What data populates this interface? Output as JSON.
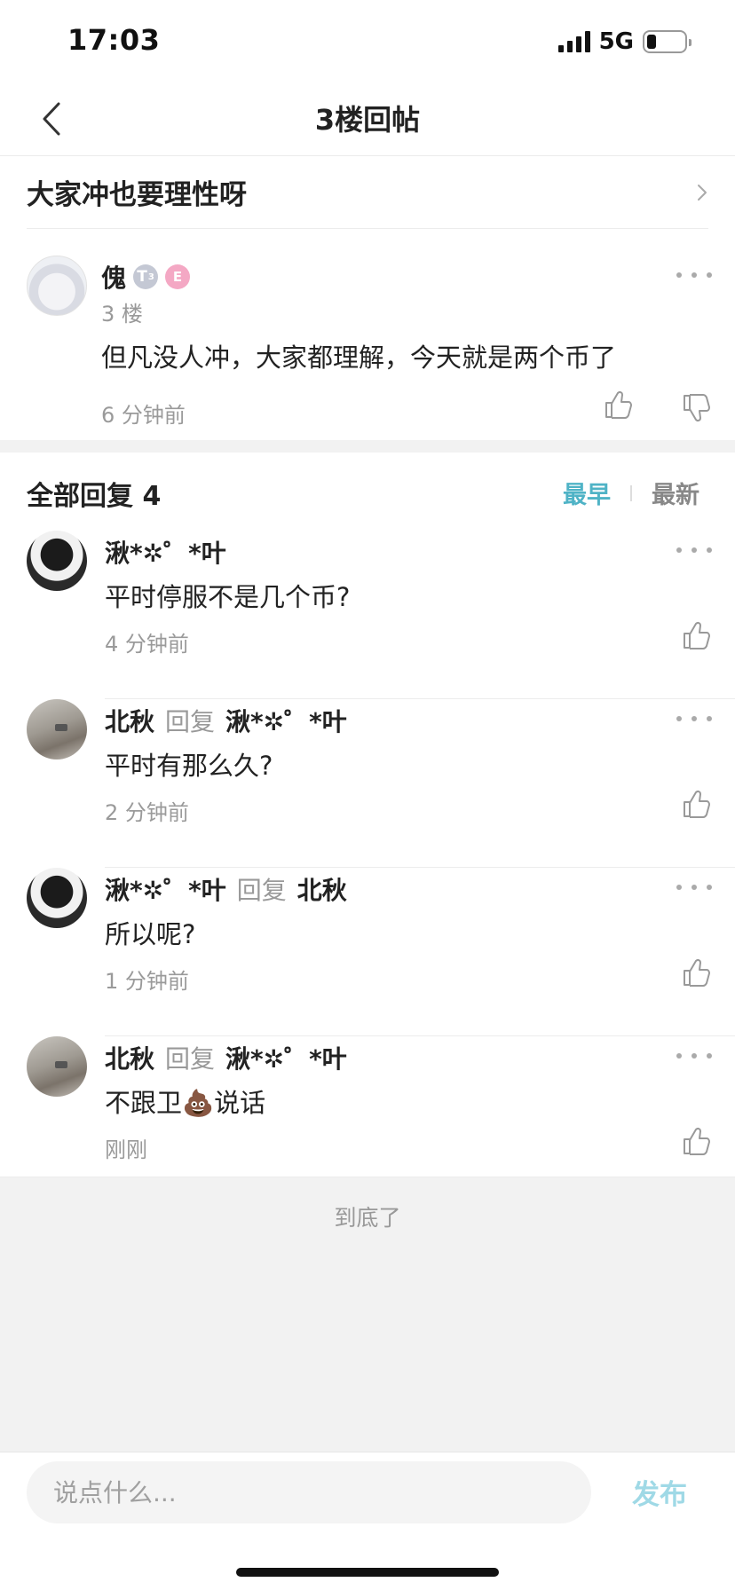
{
  "status_bar": {
    "time": "17:03",
    "network": "5G",
    "battery_percent": 25
  },
  "nav": {
    "title": "3楼回帖",
    "back_icon": "chevron-left-icon"
  },
  "thread": {
    "title": "大家冲也要理性呀",
    "arrow_icon": "chevron-right-icon"
  },
  "post": {
    "username": "傀",
    "badge_level": "T",
    "badge_sub": "3",
    "badge_extra": "E",
    "floor": "3 楼",
    "content": "但凡没人冲，大家都理解，今天就是两个币了",
    "time": "6 分钟前"
  },
  "replies_header": {
    "title": "全部回复 4",
    "sort_earliest": "最早",
    "sort_latest": "最新"
  },
  "replies": [
    {
      "username": "湫*✲゜*叶",
      "reply_word": "",
      "reply_to": "",
      "content": "平时停服不是几个币?",
      "time": "4 分钟前",
      "avatar": "dark"
    },
    {
      "username": "北秋",
      "reply_word": "回复",
      "reply_to": "湫*✲゜*叶",
      "content": "平时有那么久?",
      "time": "2 分钟前",
      "avatar": "winter"
    },
    {
      "username": "湫*✲゜*叶",
      "reply_word": "回复",
      "reply_to": "北秋",
      "content": "所以呢?",
      "time": "1 分钟前",
      "avatar": "dark"
    },
    {
      "username": "北秋",
      "reply_word": "回复",
      "reply_to": "湫*✲゜*叶",
      "content": "不跟卫💩说话",
      "time": "刚刚",
      "avatar": "winter"
    }
  ],
  "footer": {
    "end_text": "到底了"
  },
  "input_bar": {
    "placeholder": "说点什么...",
    "publish_label": "发布"
  },
  "colors": {
    "accent": "#4fb3c6",
    "publish_disabled": "#9fd9e6",
    "muted": "#999999",
    "divider": "#ececec",
    "band": "#f2f2f2"
  }
}
